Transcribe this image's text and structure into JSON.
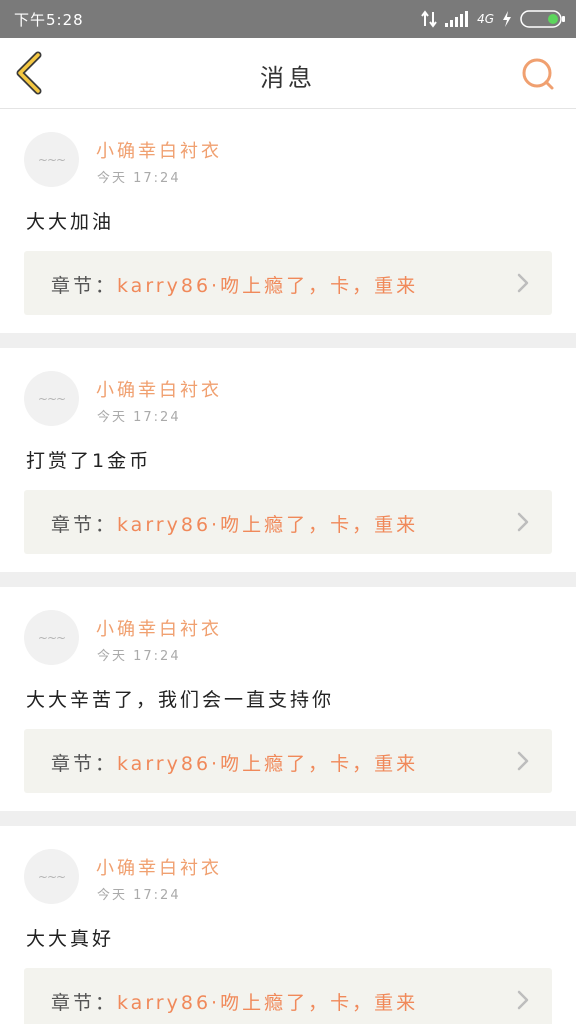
{
  "status_bar": {
    "time": "下午5:28",
    "network": "4G"
  },
  "header": {
    "back_icon": "chevron-left-icon",
    "title": "消息",
    "search_icon": "search-icon"
  },
  "colors": {
    "accent": "#f0a070",
    "chapter_title": "#f0895a",
    "back_icon": "#f5c842",
    "status_bar_bg": "#7a7a7a"
  },
  "messages": [
    {
      "username": "小确幸白衬衣",
      "time": "今天 17:24",
      "content": "大大加油",
      "chapter_label": "章节：",
      "chapter_title": "karry86·吻上瘾了，卡，重来"
    },
    {
      "username": "小确幸白衬衣",
      "time": "今天 17:24",
      "content": "打赏了1金币",
      "chapter_label": "章节：",
      "chapter_title": "karry86·吻上瘾了，卡，重来"
    },
    {
      "username": "小确幸白衬衣",
      "time": "今天 17:24",
      "content": "大大辛苦了，我们会一直支持你",
      "chapter_label": "章节：",
      "chapter_title": "karry86·吻上瘾了，卡，重来"
    },
    {
      "username": "小确幸白衬衣",
      "time": "今天 17:24",
      "content": "大大真好",
      "chapter_label": "章节：",
      "chapter_title": "karry86·吻上瘾了，卡，重来"
    }
  ]
}
